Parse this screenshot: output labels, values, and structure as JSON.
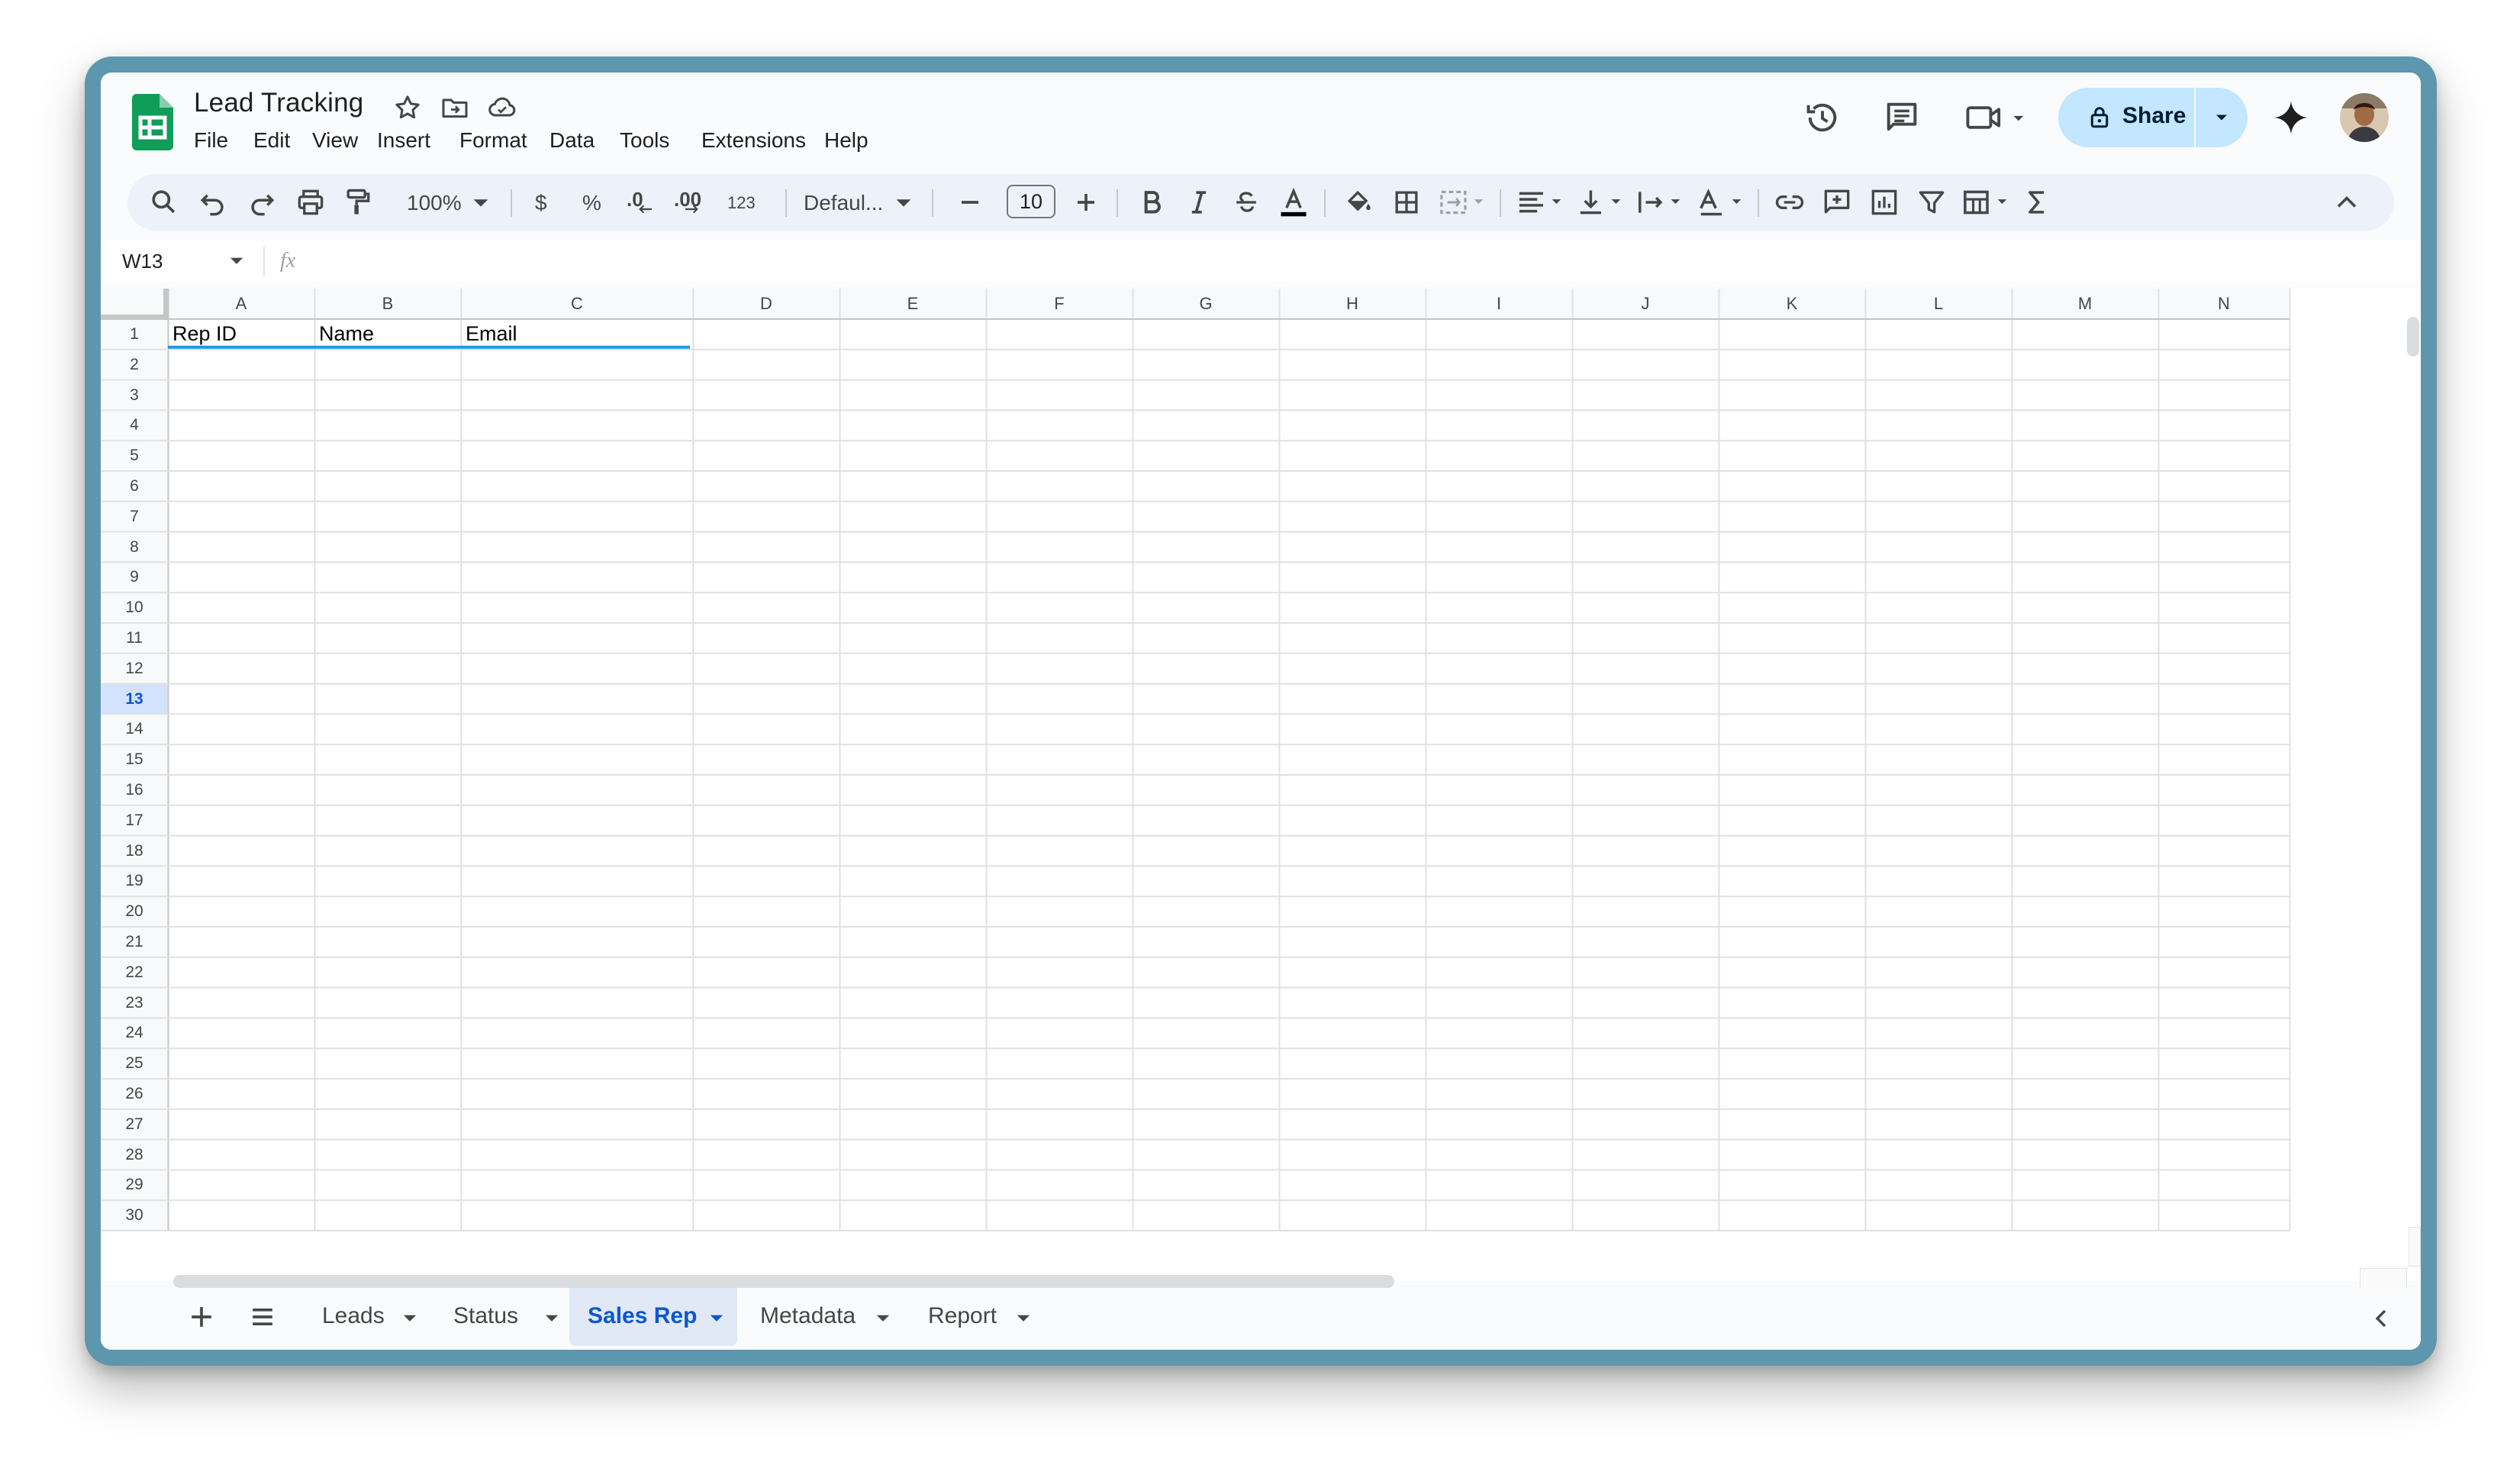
{
  "document": {
    "title": "Lead Tracking"
  },
  "menu": [
    "File",
    "Edit",
    "View",
    "Insert",
    "Format",
    "Data",
    "Tools",
    "Extensions",
    "Help"
  ],
  "share": {
    "label": "Share"
  },
  "toolbar": {
    "zoom": "100%",
    "currency": "$",
    "percent": "%",
    "decrease_decimal": ".0",
    "increase_decimal": ".00",
    "number_format": "123",
    "font": "Defaul...",
    "font_size": "10"
  },
  "formula_bar": {
    "cell_ref": "W13",
    "fx": "fx",
    "value": ""
  },
  "grid": {
    "columns": [
      "A",
      "B",
      "C",
      "D",
      "E",
      "F",
      "G",
      "H",
      "I",
      "J",
      "K",
      "L",
      "M",
      "N"
    ],
    "row_count": 30,
    "selected_row": 13,
    "header_row": [
      "Rep ID",
      "Name",
      "Email"
    ]
  },
  "sheets": [
    {
      "name": "Leads",
      "active": false
    },
    {
      "name": "Status",
      "active": false
    },
    {
      "name": "Sales Rep",
      "active": true
    },
    {
      "name": "Metadata",
      "active": false
    },
    {
      "name": "Report",
      "active": false
    }
  ],
  "colors": {
    "accent": "#0b57d0",
    "share_bg": "#c2e7ff",
    "toolbar_bg": "#edf2fa",
    "table_underline": "#1a9be0",
    "selected_header": "#d3e3fd",
    "sheets_green": "#0f9d58"
  }
}
